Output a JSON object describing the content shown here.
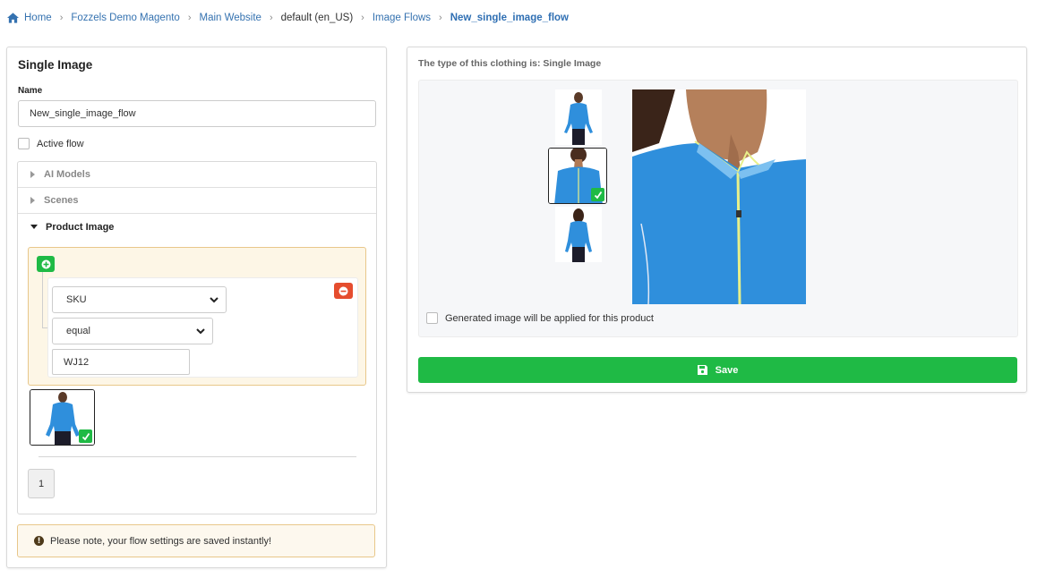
{
  "breadcrumb": {
    "items": [
      "Home",
      "Fozzels Demo Magento",
      "Main Website",
      "default (en_US)",
      "Image Flows",
      "New_single_image_flow"
    ]
  },
  "left_panel": {
    "title": "Single Image",
    "name_label": "Name",
    "name_value": "New_single_image_flow",
    "active_flow_label": "Active flow",
    "active_flow_checked": false,
    "accordion": {
      "items": [
        "AI Models",
        "Scenes",
        "Product Image"
      ],
      "open_item": "Product Image"
    },
    "condition": {
      "attribute": "SKU",
      "operator": "equal",
      "value": "WJ12"
    },
    "pagination": {
      "page": "1"
    },
    "notice": "Please note, your flow settings are saved instantly!"
  },
  "right_panel": {
    "type_text": "The type of this clothing is: Single Image",
    "apply_label": "Generated image will be applied for this product",
    "apply_checked": false,
    "save_label": "Save"
  },
  "colors": {
    "accent_green": "#1fba45",
    "danger_red": "#e54d2e",
    "link_blue": "#3572b0",
    "product_blue": "#2f8fdc"
  },
  "icons": [
    "home-icon",
    "chevron-right-icon",
    "plus-circle-icon",
    "minus-circle-icon",
    "chevron-down-icon",
    "check-icon",
    "info-icon",
    "save-icon"
  ]
}
